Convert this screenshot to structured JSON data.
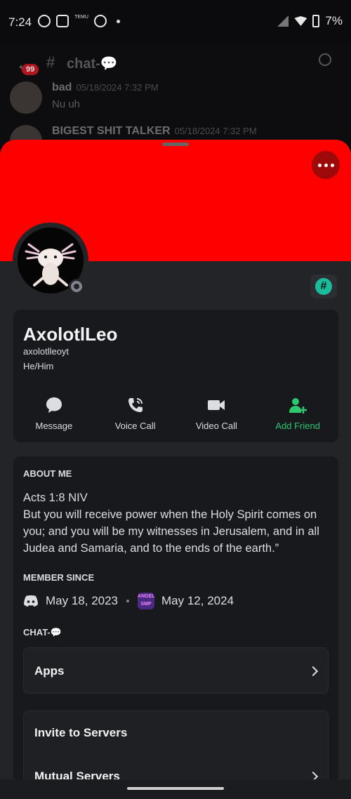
{
  "status_bar": {
    "time": "7:24",
    "battery": "7%",
    "left_icons": [
      "threads-icon",
      "game-controller-icon",
      "temu-icon",
      "xbox-icon"
    ],
    "temu_text": "TEMU"
  },
  "chat_header": {
    "unread_count": "99",
    "channel_name": "chat-💬"
  },
  "background_messages": [
    {
      "author": "bad",
      "timestamp": "05/18/2024 7:32 PM",
      "text": "Nu uh"
    },
    {
      "author": "BIGEST SHIT TALKER",
      "timestamp": "05/18/2024 7:32 PM",
      "text": ""
    }
  ],
  "profile": {
    "banner_color": "#ff0000",
    "display_name": "AxolotlLeo",
    "username": "axolotlleoyt",
    "pronouns": "He/Him",
    "status": "offline"
  },
  "actions": [
    {
      "label": "Message",
      "icon": "chat-bubble-icon"
    },
    {
      "label": "Voice Call",
      "icon": "phone-icon"
    },
    {
      "label": "Video Call",
      "icon": "video-camera-icon"
    },
    {
      "label": "Add Friend",
      "icon": "add-friend-icon"
    }
  ],
  "about_me": {
    "title": "ABOUT ME",
    "text": "Acts 1:8 NIV\nBut you will receive power when the Holy Spirit comes on you; and you will be my witnesses in Jerusalem, and in all Judea and Samaria, and to the ends of the earth.”"
  },
  "member_since": {
    "title": "MEMBER SINCE",
    "discord_date": "May 18, 2023",
    "server_date": "May 12, 2024",
    "server_icon_text": "ANGEL SMP"
  },
  "server_section": {
    "title": "CHAT-💬",
    "apps_label": "Apps",
    "invite_label": "Invite to Servers",
    "mutual_label": "Mutual Servers"
  },
  "colors": {
    "accent_green": "#2dc770",
    "sheet_bg": "#232428",
    "card_bg": "#18191c"
  }
}
